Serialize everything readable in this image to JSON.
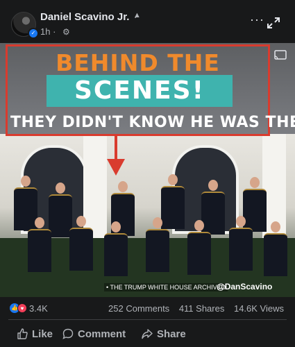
{
  "post": {
    "author": "Daniel Scavino Jr.",
    "author_suffix": "·",
    "time": "1h ·",
    "more_label": "···"
  },
  "video": {
    "title_line1": "BEHIND THE",
    "title_line2": "SCENES!",
    "caption": "THEY DIDN'T KNOW HE WAS THERE...",
    "watermark_left": "• THE TRUMP WHITE HOUSE ARCHIVED",
    "watermark_right": "@DanScavino"
  },
  "stats": {
    "reactions": "3.4K",
    "comments": "252 Comments",
    "shares": "411 Shares",
    "views": "14.6K Views"
  },
  "actions": {
    "like": "Like",
    "comment": "Comment",
    "share": "Share"
  },
  "colors": {
    "background": "#18191a",
    "accent_blue": "#1877f2",
    "highlight_red": "#d93b2e",
    "title_orange": "#f08a2c",
    "title_teal": "#3fb3ae"
  }
}
